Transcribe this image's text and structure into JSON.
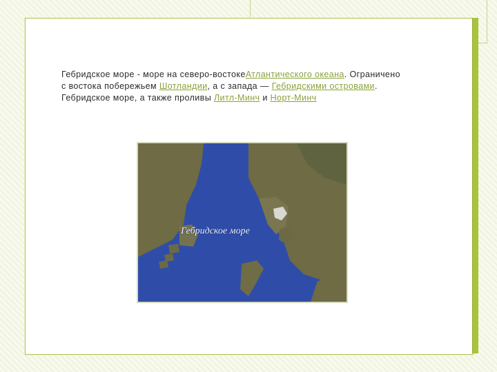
{
  "paragraph": {
    "t1": "Гебридское море - море на северо-востоке",
    "link1": "Атлантического океана",
    "t2": ". Ограничено с востока побережьем ",
    "link2": "Шотландии",
    "t3": ", а с запада — ",
    "link3": "Гебридскими островами",
    "t4": ". Гебридское море, а также проливы ",
    "link4": "Литл-Минч",
    "t5": " и ",
    "link5": "Норт-Минч"
  },
  "map": {
    "label": "Гебридское море",
    "sea_color": "#2d4aa6",
    "land_color": "#6d6b45"
  },
  "accent": "#a7c43a"
}
